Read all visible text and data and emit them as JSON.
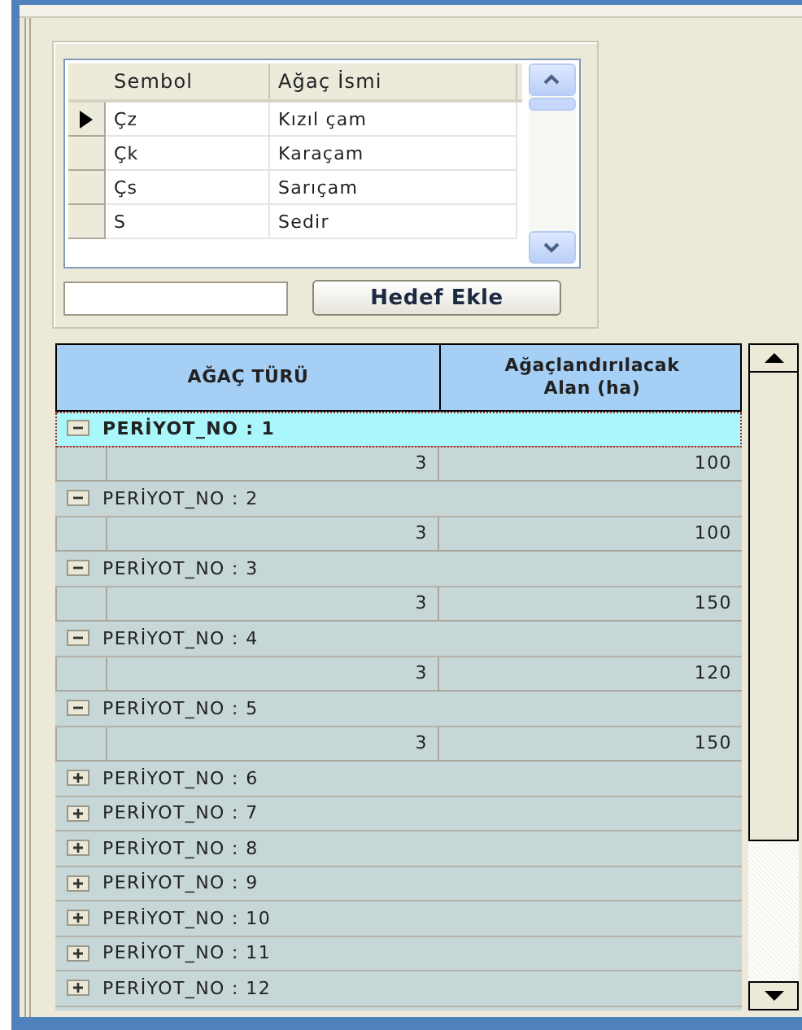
{
  "species_grid": {
    "columns": [
      "Sembol",
      "Ağaç İsmi"
    ],
    "rows": [
      {
        "symbol": "Çz",
        "name": "Kızıl çam",
        "selected": true
      },
      {
        "symbol": "Çk",
        "name": "Karaçam",
        "selected": false
      },
      {
        "symbol": "Çs",
        "name": "Sarıçam",
        "selected": false
      },
      {
        "symbol": "S",
        "name": "Sedir",
        "selected": false
      }
    ]
  },
  "add_button": "Hedef Ekle",
  "period_grid": {
    "columns": [
      "AĞAÇ TÜRÜ",
      "Ağaçlandırılacak Alan (ha)"
    ],
    "groups": [
      {
        "label": "PERİYOT_NO : 1",
        "expanded": true,
        "selected": true,
        "rows": [
          {
            "tree_type": "3",
            "area": "100"
          }
        ]
      },
      {
        "label": "PERİYOT_NO : 2",
        "expanded": true,
        "selected": false,
        "rows": [
          {
            "tree_type": "3",
            "area": "100"
          }
        ]
      },
      {
        "label": "PERİYOT_NO : 3",
        "expanded": true,
        "selected": false,
        "rows": [
          {
            "tree_type": "3",
            "area": "150"
          }
        ]
      },
      {
        "label": "PERİYOT_NO : 4",
        "expanded": true,
        "selected": false,
        "rows": [
          {
            "tree_type": "3",
            "area": "120"
          }
        ]
      },
      {
        "label": "PERİYOT_NO : 5",
        "expanded": true,
        "selected": false,
        "rows": [
          {
            "tree_type": "3",
            "area": "150"
          }
        ]
      },
      {
        "label": "PERİYOT_NO : 6",
        "expanded": false,
        "selected": false
      },
      {
        "label": "PERİYOT_NO : 7",
        "expanded": false,
        "selected": false
      },
      {
        "label": "PERİYOT_NO : 8",
        "expanded": false,
        "selected": false
      },
      {
        "label": "PERİYOT_NO : 9",
        "expanded": false,
        "selected": false
      },
      {
        "label": "PERİYOT_NO : 10",
        "expanded": false,
        "selected": false
      },
      {
        "label": "PERİYOT_NO : 11",
        "expanded": false,
        "selected": false
      },
      {
        "label": "PERİYOT_NO : 12",
        "expanded": false,
        "selected": false
      }
    ]
  }
}
